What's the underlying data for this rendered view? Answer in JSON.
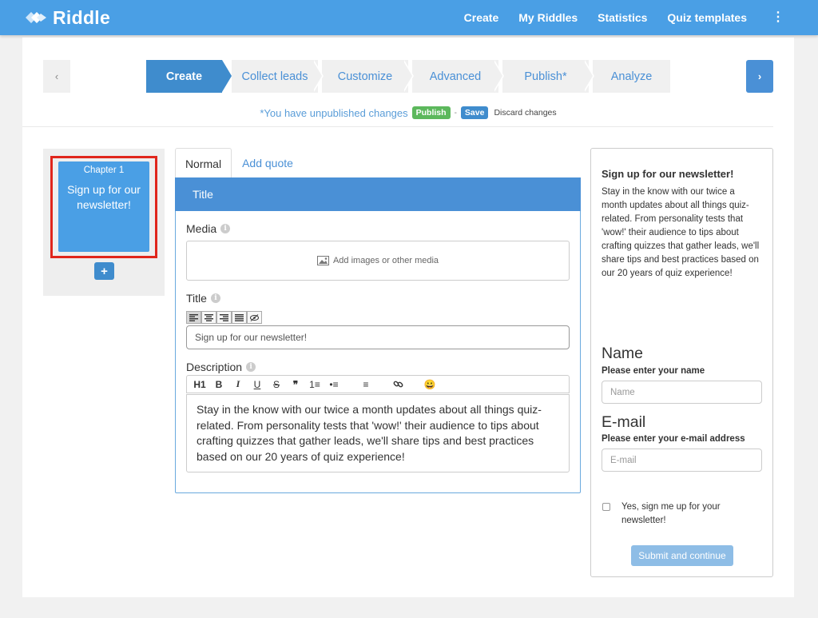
{
  "brand": {
    "name": "Riddle"
  },
  "nav": {
    "items": [
      "Create",
      "My Riddles",
      "Statistics",
      "Quiz templates"
    ],
    "more_icon": "⋮"
  },
  "steps": {
    "prev_icon": "‹",
    "next_icon": "›",
    "items": [
      "Create",
      "Collect leads",
      "Customize",
      "Advanced",
      "Publish*",
      "Analyze"
    ],
    "active": "Create"
  },
  "unpublished": {
    "text": "*You have unpublished changes",
    "publish_label": "Publish",
    "separator": "-",
    "save_label": "Save",
    "discard_label": "Discard changes"
  },
  "chapters": {
    "items": [
      {
        "label": "Chapter 1",
        "title": "Sign up for our newsletter!"
      }
    ],
    "add_label": "+"
  },
  "editor": {
    "tabs": [
      "Normal",
      "Add quote"
    ],
    "header": "Title",
    "media_label": "Media",
    "media_placeholder": "Add images or other media",
    "title_label": "Title",
    "title_value": "Sign up for our newsletter!",
    "description_label": "Description",
    "description_value": "Stay in the know with our twice a month updates about all things quiz-related. From personality tests that 'wow!' their audience to tips about crafting quizzes that gather leads, we'll share tips and best practices based on our 20 years of quiz experience!",
    "toolbar": [
      "H1",
      "B",
      "I",
      "U",
      "S",
      "❞",
      "1≡",
      "•≡",
      "≡",
      "link",
      "😀"
    ]
  },
  "preview": {
    "title": "Sign up for our newsletter!",
    "description": "Stay in the know with our twice a month updates about all things quiz-related. From personality tests that 'wow!' their audience to tips about crafting quizzes that gather leads, we'll share tips and best practices based on our 20 years of quiz experience!",
    "name_heading": "Name",
    "name_sub": "Please enter your name",
    "name_placeholder": "Name",
    "email_heading": "E-mail",
    "email_sub": "Please enter your e-mail address",
    "email_placeholder": "E-mail",
    "checkbox_label": "Yes, sign me up for your newsletter!",
    "submit_label": "Submit and continue"
  },
  "colors": {
    "brand": "#4a9fe5",
    "accent": "#3f8ccd",
    "publish": "#5cb85c",
    "highlight": "#e0261c"
  }
}
